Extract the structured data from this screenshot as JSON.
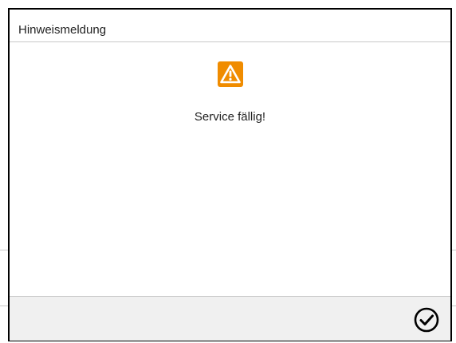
{
  "dialog": {
    "title": "Hinweismeldung",
    "icon": "warning-icon",
    "message": "Service fällig!",
    "confirm_icon": "checkmark-circle-icon"
  },
  "colors": {
    "warning": "#f08c00",
    "frame": "#000000",
    "footer": "#f0f0f0",
    "divider": "#c8c8c8"
  }
}
